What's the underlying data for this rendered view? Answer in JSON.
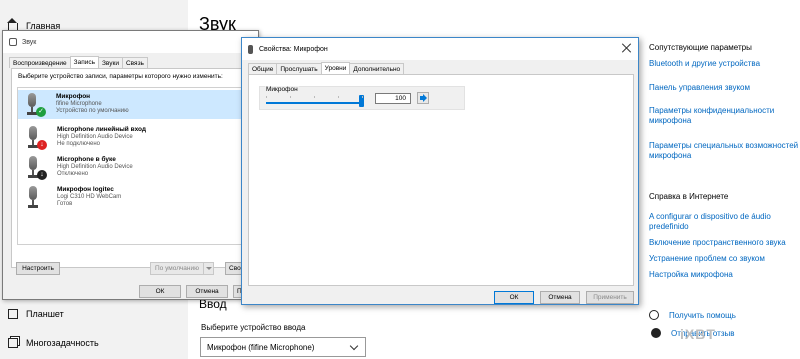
{
  "settings": {
    "nav": {
      "home": "Главная",
      "tablet": "Планшет",
      "multitask": "Многозадачность"
    },
    "title": "Звук",
    "input_heading": "Ввод",
    "device_label": "Выберите устройство ввода",
    "device_value": "Микрофон (fifine Microphone)",
    "related": {
      "heading": "Сопутствующие параметры",
      "links": [
        "Bluetooth и другие устройства",
        "Панель управления звуком",
        "Параметры конфиденциальности микрофона",
        "Параметры специальных возможностей микрофона"
      ]
    },
    "help": {
      "heading": "Справка в Интернете",
      "links": [
        "A configurar o dispositivo de áudio predefinido",
        "Включение пространственного звука",
        "Устранение проблем со звуком",
        "Настройка микрофона"
      ],
      "get_help": "Получить помощь",
      "feedback": "Отправить отзыв"
    }
  },
  "sound_dialog": {
    "title": "Звук",
    "tabs": [
      "Воспроизведение",
      "Запись",
      "Звуки",
      "Связь"
    ],
    "active_tab": 1,
    "instruction": "Выберите устройство записи, параметры которого нужно изменить:",
    "devices": [
      {
        "name": "Микрофон",
        "line1": "fifine Microphone",
        "line2": "Устройство по умолчанию",
        "badge": "✓"
      },
      {
        "name": "Microphone  линейный вход",
        "line1": "High Definition Audio Device",
        "line2": "Не подключено",
        "badge": "↓"
      },
      {
        "name": "Microphone в буке",
        "line1": "High Definition Audio Device",
        "line2": "Отключено",
        "badge": "↓"
      },
      {
        "name": "Микрофон logitec",
        "line1": "Logi C310 HD WebCam",
        "line2": "Готов",
        "badge": ""
      }
    ],
    "configure": "Настроить",
    "set_default": "По умолчанию",
    "properties_partial": "Сво",
    "ok": "ОК",
    "cancel": "Отмена",
    "apply_partial": "Пр"
  },
  "props_dialog": {
    "title": "Свойства: Микрофон",
    "tabs": [
      "Общие",
      "Прослушать",
      "Уровни",
      "Дополнительно"
    ],
    "active_tab": 2,
    "level_label": "Микрофон",
    "level_value": "100",
    "level_fraction": 1.0,
    "ok": "ОК",
    "cancel": "Отмена",
    "apply": "Применить"
  },
  "watermark": "iXBT"
}
